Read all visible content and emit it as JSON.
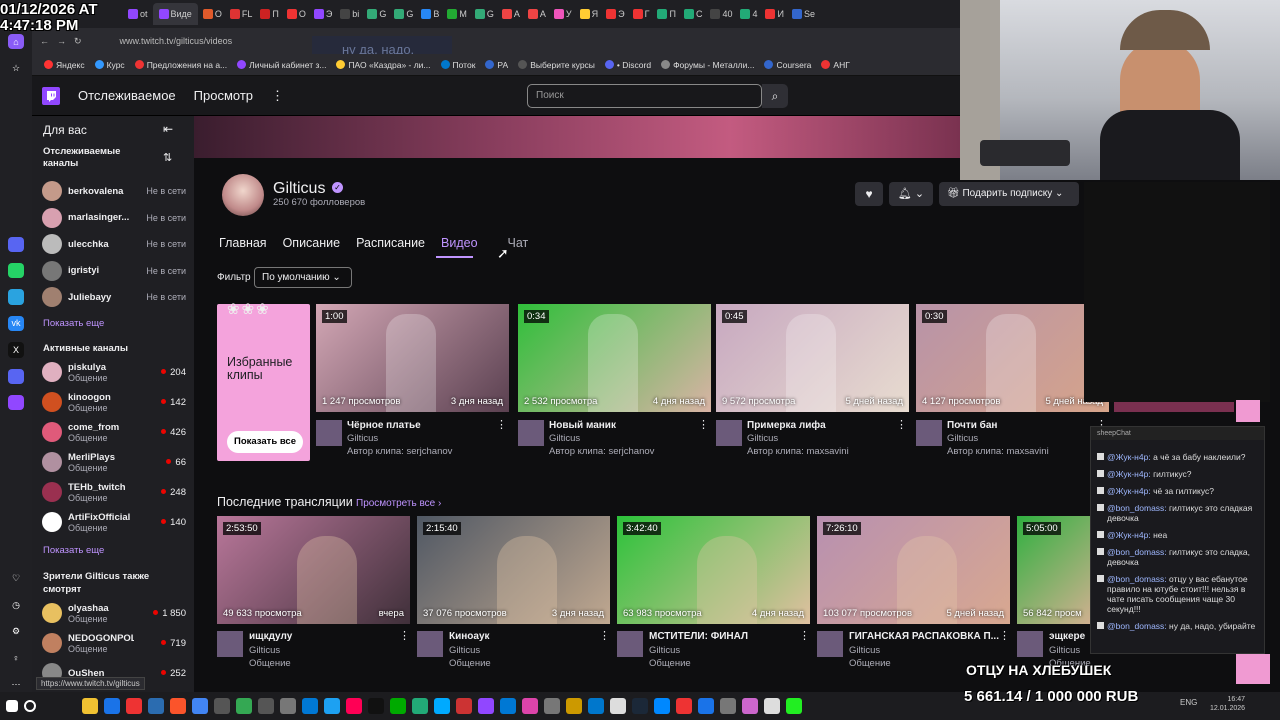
{
  "overlay": {
    "date": "01/12/2026 AT",
    "time": "4:47:18 PM",
    "stream_line1": "ОТЦУ НА ХЛЕБУШЕК",
    "stream_line2": "5 661.14 / 1 000 000 RUB",
    "ghost_chat": "ну да, надо, у"
  },
  "browser": {
    "tabs": [
      "ot",
      "Виде",
      "О",
      "FL",
      "П",
      "О",
      "Э",
      "bi",
      "G",
      "G",
      "B",
      "М",
      "G",
      "А",
      "А",
      "У",
      "Я",
      "Э",
      "Г",
      "П",
      "С",
      "40",
      "4",
      "И",
      "Se"
    ],
    "url": "www.twitch.tv/gilticus/videos",
    "status_url": "https://www.twitch.tv/gilticus",
    "bookmarks": [
      "Яндекс",
      "Курс",
      "Предложения на а...",
      "Личный кабинет з...",
      "ПАО «Каздра» - ли...",
      "Поток",
      "РА",
      "Выберите курсы",
      "• Discord",
      "Форумы - Металли...",
      "Coursera",
      "АНГ"
    ]
  },
  "twitch": {
    "logo": "twitch-glyph",
    "nav": [
      "Отслеживаемое",
      "Просмотр"
    ],
    "search_placeholder": "Поиск",
    "sidebar": {
      "for_you": "Для вас",
      "followed_title": "Отслеживаемые каналы",
      "followed": [
        {
          "name": "berkovalena",
          "status": "Не в сети",
          "color": "#c49a8a"
        },
        {
          "name": "marlasinger...",
          "status": "Не в сети",
          "color": "#d8a0b0"
        },
        {
          "name": "ulecchka",
          "status": "Не в сети",
          "color": "#bbbbbb"
        },
        {
          "name": "igristyi",
          "status": "Не в сети",
          "color": "#777777"
        },
        {
          "name": "Juliebayy",
          "status": "Не в сети",
          "color": "#a08070"
        }
      ],
      "show_more": "Показать еще",
      "active_title": "Активные каналы",
      "active": [
        {
          "name": "piskulya",
          "sub": "Общение",
          "viewers": "204",
          "color": "#e0b0c0"
        },
        {
          "name": "kinoogon",
          "sub": "Общение",
          "viewers": "142",
          "color": "#d05020"
        },
        {
          "name": "come_from",
          "sub": "Общение",
          "viewers": "426",
          "color": "#e05a7a"
        },
        {
          "name": "MerliPlays",
          "sub": "Общение",
          "viewers": "66",
          "color": "#b090a0"
        },
        {
          "name": "TEHb_twitch",
          "sub": "Общение",
          "viewers": "248",
          "color": "#9a3050"
        },
        {
          "name": "ArtiFixOfficial",
          "sub": "Общение",
          "viewers": "140",
          "color": "#ffffff"
        }
      ],
      "show_more2": "Показать еще",
      "also_title": "Зрители Gilticus также смотрят",
      "also": [
        {
          "name": "olyashaa",
          "sub": "Общение",
          "viewers": "1 850",
          "color": "#e8c060"
        },
        {
          "name": "NEDOGONPOLYA",
          "sub": "Общение",
          "viewers": "719",
          "color": "#c08060"
        },
        {
          "name": "OuShen",
          "sub": "",
          "viewers": "252",
          "color": "#888888"
        }
      ]
    },
    "channel": {
      "name": "Gilticus",
      "followers": "250 670 фолловеров",
      "subscribe": "Подарить подписку"
    },
    "tabs": [
      "Главная",
      "Описание",
      "Расписание",
      "Видео",
      "Чат"
    ],
    "filter_label": "Фильтр",
    "filter_value": "По умолчанию",
    "featured": {
      "title": "Избранные клипы",
      "button": "Показать все"
    },
    "clips": [
      {
        "dur": "1:00",
        "views": "1 247 просмотров",
        "ago": "3 дня назад",
        "title": "Чёрное платье",
        "channel": "Gilticus",
        "author": "Автор клипа: serjchanov",
        "c1": "#d3a7b5",
        "c2": "#5a4050"
      },
      {
        "dur": "0:34",
        "views": "2 532 просмотра",
        "ago": "4 дня назад",
        "title": "Новый маник",
        "channel": "Gilticus",
        "author": "Автор клипа: serjchanov",
        "c1": "#2fbf3a",
        "c2": "#d9b3a5"
      },
      {
        "dur": "0:45",
        "views": "9 572 просмотра",
        "ago": "5 дней назад",
        "title": "Примерка лифа",
        "channel": "Gilticus",
        "author": "Автор клипа: maxsavini",
        "c1": "#c7a8c0",
        "c2": "#e8dcd0"
      },
      {
        "dur": "0:30",
        "views": "4 127 просмотров",
        "ago": "5 дней назад",
        "title": "Почти бан",
        "channel": "Gilticus",
        "author": "Автор клипа: maxsavini",
        "c1": "#b893a8",
        "c2": "#d6a48a"
      }
    ],
    "recent_title": "Последние трансляции",
    "recent_link": "Просмотреть все ›",
    "streams": [
      {
        "dur": "2:53:50",
        "views": "49 633 просмотра",
        "ago": "вчера",
        "title": "ищкдулу",
        "channel": "Gilticus",
        "cat": "Общение",
        "c1": "#b9779a",
        "c2": "#40303a"
      },
      {
        "dur": "2:15:40",
        "views": "37 076 просмотров",
        "ago": "3 дня назад",
        "title": "Киноаук",
        "channel": "Gilticus",
        "cat": "Общение",
        "c1": "#505864",
        "c2": "#c0a890"
      },
      {
        "dur": "3:42:40",
        "views": "63 983 просмотра",
        "ago": "4 дня назад",
        "title": "МСТИТЕЛИ: ФИНАЛ",
        "channel": "Gilticus",
        "cat": "Общение",
        "c1": "#2cc23a",
        "c2": "#e0c0a0"
      },
      {
        "dur": "7:26:10",
        "views": "103 077 просмотров",
        "ago": "5 дней назад",
        "title": "ГИГАНСКАЯ РАСПАКОВКА П...",
        "channel": "Gilticus",
        "cat": "Общение",
        "c1": "#b890b0",
        "c2": "#d8a890"
      },
      {
        "dur": "5:05:00",
        "views": "56 842 просм",
        "ago": "",
        "title": "эщкере",
        "channel": "Gilticus",
        "cat": "Общение",
        "c1": "#30b040",
        "c2": "#d0b090"
      }
    ]
  },
  "chat": {
    "header": "sheepChat",
    "messages": [
      {
        "user": "@Жук-н4р:",
        "text": "а чё за бабу наклеили?"
      },
      {
        "user": "@Жук-н4р:",
        "text": "гилтикус?"
      },
      {
        "user": "@Жук-н4р:",
        "text": "чё за гилтикус?"
      },
      {
        "user": "@bon_domass:",
        "text": "гилтикус это сладкая девочка"
      },
      {
        "user": "@Жук-н4р:",
        "text": "неа"
      },
      {
        "user": "@bon_domass:",
        "text": "гилтикус это сладка, девочка"
      },
      {
        "user": "@bon_domass:",
        "text": "отцу у вас ебанутое правило на ютубе стоит!!! нельзя в чате писать сообщения чаще 30 секунд!!!"
      },
      {
        "user": "@bon_domass:",
        "text": "ну да, надо, убирайте"
      }
    ]
  },
  "taskbar": {
    "lang": "ENG",
    "clock": "16:47",
    "date": "12.01.2026"
  }
}
